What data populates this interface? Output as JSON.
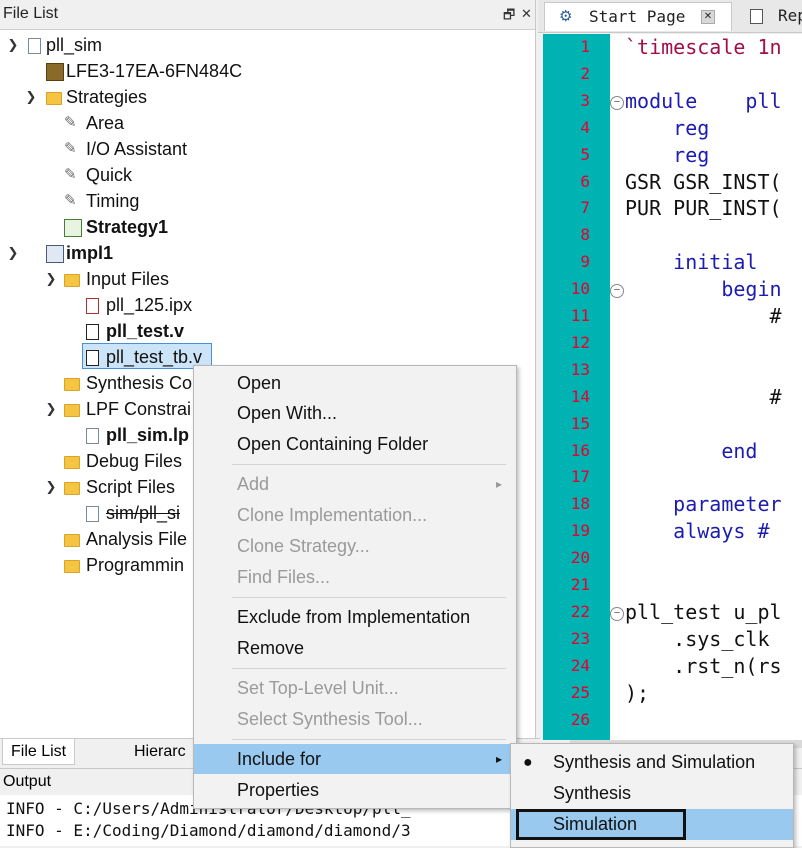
{
  "file_panel": {
    "title": "File List",
    "controls": [
      "🗗",
      "✕"
    ],
    "tree": [
      {
        "label": "pll_sim",
        "icon": "project-icon",
        "bold": false
      },
      {
        "label": "LFE3-17EA-6FN484C",
        "icon": "device-icon",
        "bold": false
      },
      {
        "label": "Strategies",
        "icon": "folder-icon",
        "bold": false
      },
      {
        "label": "Area",
        "icon": "strategy-icon",
        "bold": false
      },
      {
        "label": "I/O Assistant",
        "icon": "strategy-icon",
        "bold": false
      },
      {
        "label": "Quick",
        "icon": "strategy-icon",
        "bold": false
      },
      {
        "label": "Timing",
        "icon": "strategy-icon",
        "bold": false
      },
      {
        "label": "Strategy1",
        "icon": "active-strategy-icon",
        "bold": true
      },
      {
        "label": "impl1",
        "icon": "implementation-icon",
        "bold": true
      },
      {
        "label": "Input Files",
        "icon": "folder-icon",
        "bold": false
      },
      {
        "label": "pll_125.ipx",
        "icon": "ipx-file-icon",
        "bold": false
      },
      {
        "label": "pll_test.v",
        "icon": "verilog-file-icon",
        "bold": true
      },
      {
        "label": "pll_test_tb.v",
        "icon": "verilog-file-icon",
        "bold": false
      },
      {
        "label": "Synthesis Co",
        "icon": "folder-icon",
        "bold": false
      },
      {
        "label": "LPF Constrai",
        "icon": "folder-icon",
        "bold": false
      },
      {
        "label": "pll_sim.lp",
        "icon": "lpf-file-icon",
        "bold": true
      },
      {
        "label": "Debug Files",
        "icon": "folder-icon",
        "bold": false
      },
      {
        "label": "Script Files",
        "icon": "folder-icon",
        "bold": false
      },
      {
        "label": "sim/pll_si",
        "icon": "script-file-icon",
        "bold": false
      },
      {
        "label": "Analysis File",
        "icon": "folder-icon",
        "bold": false
      },
      {
        "label": "Programmin",
        "icon": "folder-icon",
        "bold": false
      }
    ]
  },
  "bottom_tabs": [
    "File List",
    "Hierarc"
  ],
  "output": {
    "title": "Output",
    "lines": [
      "INFO - C:/Users/Administrator/Desktop/pll_",
      "INFO - E:/Coding/Diamond/diamond/diamond/3"
    ]
  },
  "editor": {
    "tabs": [
      {
        "label": "Start Page",
        "icon": "start-page-icon"
      },
      {
        "label": "Rep",
        "icon": "report-icon"
      }
    ],
    "line_numbers": [
      "1",
      "2",
      "3",
      "4",
      "5",
      "6",
      "7",
      "8",
      "9",
      "10",
      "11",
      "12",
      "13",
      "14",
      "15",
      "16",
      "17",
      "18",
      "19",
      "20",
      "21",
      "22",
      "23",
      "24",
      "25",
      "26"
    ],
    "code": [
      "`timescale 1n",
      "",
      "module    pll",
      "    reg",
      "    reg",
      "GSR GSR_INST(",
      "PUR PUR_INST(",
      "",
      "    initial",
      "        begin",
      "            #",
      "",
      "",
      "            #",
      "",
      "        end",
      "",
      "    parameter",
      "    always #",
      "",
      "",
      "pll_test u_pl",
      "    .sys_clk",
      "    .rst_n(rs",
      ");",
      ""
    ]
  },
  "context_menu": {
    "open": "Open",
    "open_with": "Open With...",
    "open_containing_folder": "Open Containing Folder",
    "add": "Add",
    "clone_implementation": "Clone Implementation...",
    "clone_strategy": "Clone Strategy...",
    "find_files": "Find Files...",
    "exclude_from_implementation": "Exclude from Implementation",
    "remove": "Remove",
    "set_top_level_unit": "Set Top-Level Unit...",
    "select_synthesis_tool": "Select Synthesis Tool...",
    "include_for": "Include for",
    "properties": "Properties"
  },
  "submenu": {
    "synthesis_and_simulation": "Synthesis and Simulation",
    "synthesis": "Synthesis",
    "simulation": "Simulation"
  },
  "colors": {
    "gutter": "#00b3b3",
    "line_number": "#e6002e",
    "menu_highlight": "#99c9ef",
    "keyword": "#1c1cb0"
  }
}
